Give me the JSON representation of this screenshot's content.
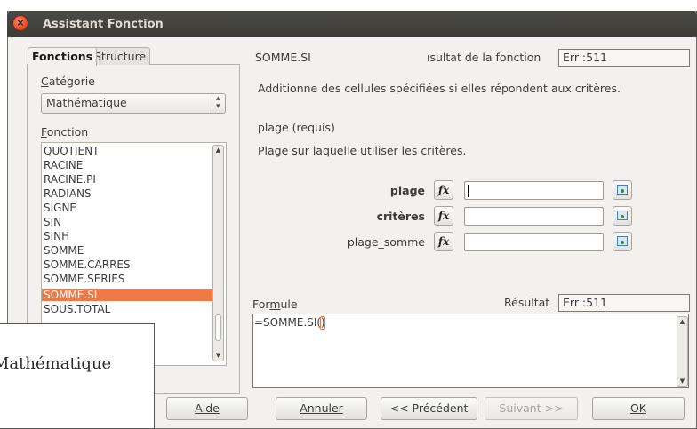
{
  "window": {
    "title": "Assistant Fonction"
  },
  "tabs": [
    {
      "label": "Fonctions"
    },
    {
      "label": "Structure"
    }
  ],
  "category": {
    "label": "Catégorie",
    "value": "Mathématique"
  },
  "function_list": {
    "label": "Fonction",
    "items": [
      "QUOTIENT",
      "RACINE",
      "RACINE.PI",
      "RADIANS",
      "SIGNE",
      "SIN",
      "SINH",
      "SOMME",
      "SOMME.CARRES",
      "SOMME.SERIES",
      "SOMME.SI",
      "SOUS.TOTAL"
    ],
    "selected": "SOMME.SI"
  },
  "detail": {
    "function_name": "SOMME.SI",
    "result_label": "ısultat de la fonction",
    "result_value": "Err :511",
    "description": "Additionne des cellules spécifiées si elles répondent aux critères.",
    "param_name": "plage (requis)",
    "param_desc": "Plage sur laquelle utiliser les critères."
  },
  "arguments": [
    {
      "label": "plage",
      "fx": "fx",
      "value": ""
    },
    {
      "label": "critères",
      "fx": "fx",
      "value": ""
    },
    {
      "label": "plage_somme",
      "fx": "fx",
      "value": ""
    }
  ],
  "formula": {
    "label": "Formule",
    "result_label": "Résultat",
    "result_value": "Err :511",
    "text": "=SOMME.SI()"
  },
  "buttons": {
    "aide": "Aide",
    "annuler": "Annuler",
    "precedent": "<< Précédent",
    "suivant": "Suivant >>",
    "ok": "OK"
  },
  "tooltip": {
    "text": "Mathématique"
  },
  "colors": {
    "titlebar": "#3c3b37",
    "selection": "#f07746",
    "close": "#e0522b"
  }
}
